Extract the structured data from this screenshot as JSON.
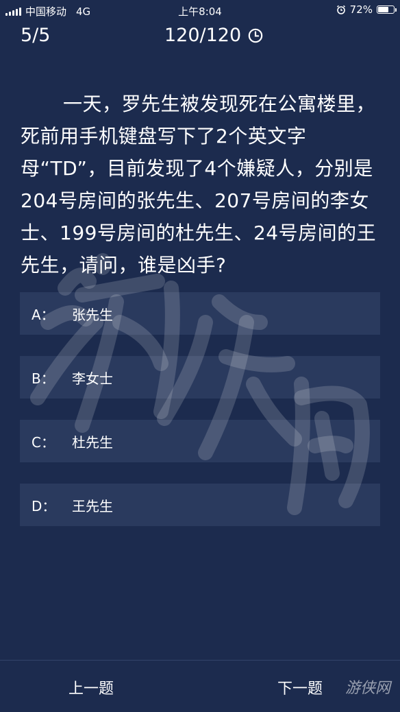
{
  "status_bar": {
    "carrier": "中国移动",
    "network": "4G",
    "time": "上午8:04",
    "battery_text": "72%",
    "battery_level": 0.72
  },
  "header": {
    "progress": "5/5",
    "timer": "120/120"
  },
  "question": {
    "text": "一天，罗先生被发现死在公寓楼里，死前用手机键盘写下了2个英文字母“TD”，目前发现了4个嫌疑人，分别是204号房间的张先生、207号房间的李女士、199号房间的杜先生、24号房间的王先生，请问，谁是凶手?"
  },
  "options": [
    {
      "letter": "A：",
      "text": "张先生"
    },
    {
      "letter": "B：",
      "text": "李女士"
    },
    {
      "letter": "C：",
      "text": "杜先生"
    },
    {
      "letter": "D：",
      "text": "王先生"
    }
  ],
  "nav": {
    "prev": "上一题",
    "next": "下一题"
  },
  "watermark": {
    "text": "游侠网"
  },
  "icons": {
    "clock": "clock-icon",
    "alarm": "alarm-icon",
    "signal": "signal-icon",
    "battery": "battery-icon"
  }
}
